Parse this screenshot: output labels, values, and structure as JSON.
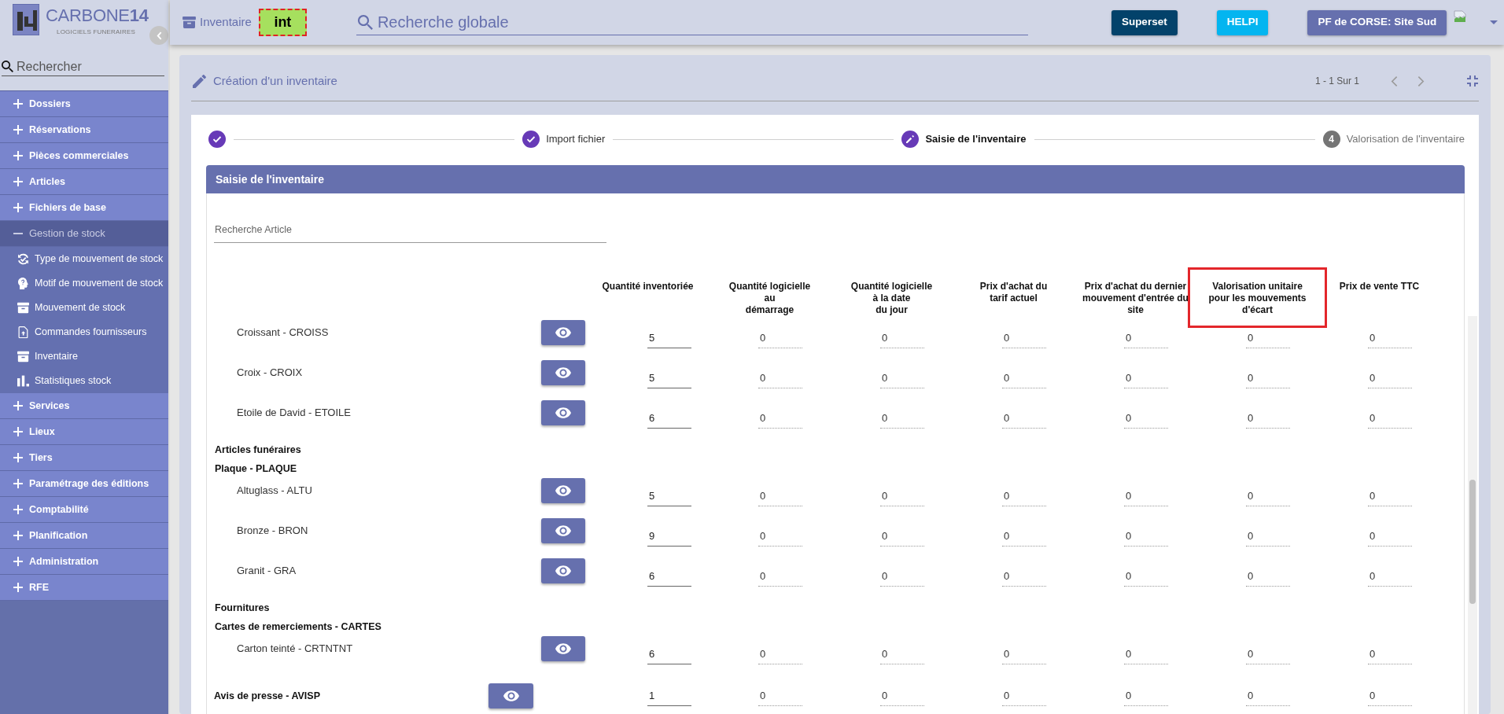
{
  "sidebar": {
    "brand": "CARBONE**14**",
    "tagline": "LOGICIELS FUNERAIRES",
    "search": {
      "placeholder": "Rechercher"
    },
    "menu": [
      {
        "label": "Dossiers",
        "expanded": false
      },
      {
        "label": "Réservations",
        "expanded": false
      },
      {
        "label": "Pièces commerciales",
        "expanded": false
      },
      {
        "label": "Articles",
        "expanded": false
      },
      {
        "label": "Fichiers de base",
        "expanded": false
      },
      {
        "label": "Gestion de stock",
        "expanded": true,
        "children": [
          {
            "label": "Type de mouvement de stock"
          },
          {
            "label": "Motif de mouvement de stock"
          },
          {
            "label": "Mouvement de stock"
          },
          {
            "label": "Commandes fournisseurs"
          },
          {
            "label": "Inventaire"
          },
          {
            "label": "Statistiques stock"
          }
        ]
      },
      {
        "label": "Services",
        "expanded": false
      },
      {
        "label": "Lieux",
        "expanded": false
      },
      {
        "label": "Tiers",
        "expanded": false
      },
      {
        "label": "Paramétrage des éditions",
        "expanded": false
      },
      {
        "label": "Comptabilité",
        "expanded": false
      },
      {
        "label": "Planification",
        "expanded": false
      },
      {
        "label": "Administration",
        "expanded": false
      },
      {
        "label": "RFE",
        "expanded": false
      }
    ]
  },
  "header": {
    "module": "Inventaire",
    "environment": "int",
    "search": {
      "placeholder": "Recherche globale"
    },
    "buttons": [
      {
        "label": "Superset",
        "kind": "dark"
      },
      {
        "label": "HELPI",
        "kind": "info"
      },
      {
        "label": "PF de CORSE: Site Sud",
        "kind": "primary"
      }
    ]
  },
  "page": {
    "title": "Création d'un inventaire",
    "pagination": "1 - 1 Sur 1",
    "steps": [
      {
        "kind": "completed"
      },
      {
        "kind": "completed",
        "label": "Import fichier"
      },
      {
        "kind": "current",
        "label": "Saisie de l'inventaire"
      },
      {
        "kind": "upcoming",
        "number": "4",
        "label": "Valorisation de l'inventaire"
      }
    ],
    "section": {
      "title": "Saisie de l'inventaire",
      "search": {
        "placeholder": "Recherche Article"
      },
      "columns": [
        {
          "lines": [
            "Quantité inventoriée"
          ],
          "highlighted": false
        },
        {
          "lines": [
            "Quantité logicielle",
            "au",
            "démarrage"
          ],
          "highlighted": false
        },
        {
          "lines": [
            "Quantité logicielle",
            "à la date",
            "du jour"
          ],
          "highlighted": false
        },
        {
          "lines": [
            "Prix d'achat du",
            "tarif actuel"
          ],
          "highlighted": false
        },
        {
          "lines": [
            "Prix d'achat du dernier",
            "mouvement d'entrée du",
            "site"
          ],
          "highlighted": false
        },
        {
          "lines": [
            "Valorisation unitaire",
            "pour les mouvements",
            "d'écart"
          ],
          "highlighted": true
        },
        {
          "lines": [
            "Prix de vente TTC"
          ],
          "highlighted": false
        }
      ],
      "rows": [
        {
          "kind": "subgroup",
          "children": [
            {
              "kind": "item",
              "label": "Croissant - CROISS",
              "quantity": "5",
              "values": [
                "0",
                "0",
                "0",
                "0",
                "0",
                "0"
              ]
            },
            {
              "kind": "item",
              "label": "Croix - CROIX",
              "quantity": "5",
              "values": [
                "0",
                "0",
                "0",
                "0",
                "0",
                "0"
              ]
            },
            {
              "kind": "item",
              "label": "Etoile de David - ETOILE",
              "quantity": "6",
              "values": [
                "0",
                "0",
                "0",
                "0",
                "0",
                "0"
              ]
            }
          ]
        },
        {
          "kind": "group",
          "label": "Articles funéraires",
          "children": [
            {
              "kind": "subgroup",
              "label": "Plaque - PLAQUE",
              "children": [
                {
                  "kind": "item",
                  "label": "Altuglass - ALTU",
                  "quantity": "5",
                  "values": [
                    "0",
                    "0",
                    "0",
                    "0",
                    "0",
                    "0"
                  ]
                },
                {
                  "kind": "item",
                  "label": "Bronze - BRON",
                  "quantity": "9",
                  "values": [
                    "0",
                    "0",
                    "0",
                    "0",
                    "0",
                    "0"
                  ]
                },
                {
                  "kind": "item",
                  "label": "Granit - GRA",
                  "quantity": "6",
                  "values": [
                    "0",
                    "0",
                    "0",
                    "0",
                    "0",
                    "0"
                  ]
                }
              ]
            }
          ]
        },
        {
          "kind": "group",
          "label": "Fournitures",
          "children": [
            {
              "kind": "subgroup",
              "label": "Cartes de remerciements - CARTES",
              "children": [
                {
                  "kind": "item",
                  "label": "Carton teinté - CRTNTNT",
                  "quantity": "6",
                  "values": [
                    "0",
                    "0",
                    "0",
                    "0",
                    "0",
                    "0"
                  ]
                }
              ]
            },
            {
              "kind": "article",
              "label": "Avis de presse - AVISP",
              "quantity": "1",
              "values": [
                "0",
                "0",
                "0",
                "0",
                "0",
                "0"
              ]
            }
          ]
        }
      ]
    }
  }
}
